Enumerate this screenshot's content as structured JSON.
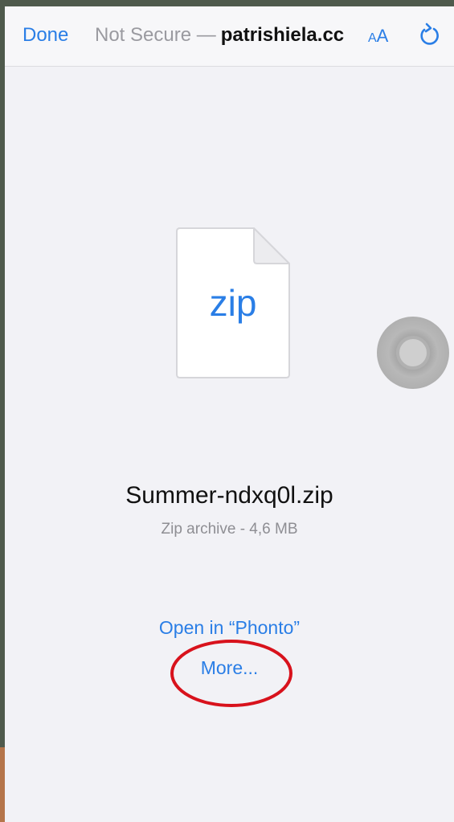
{
  "toolbar": {
    "done_label": "Done",
    "url_prefix": "Not Secure —",
    "url_domain": "patrishiela.cc",
    "text_size_small": "A",
    "text_size_large": "A"
  },
  "file": {
    "extension": "zip",
    "name": "Summer-ndxq0l.zip",
    "meta": "Zip archive - 4,6 MB"
  },
  "actions": {
    "open_in": "Open in “Phonto”",
    "more": "More..."
  },
  "colors": {
    "accent": "#2a7ee6",
    "annotation": "#d8121c",
    "background": "#f2f2f6"
  },
  "icons": {
    "reload": "reload-icon",
    "file": "document-icon",
    "assistive": "assistive-touch-icon"
  }
}
